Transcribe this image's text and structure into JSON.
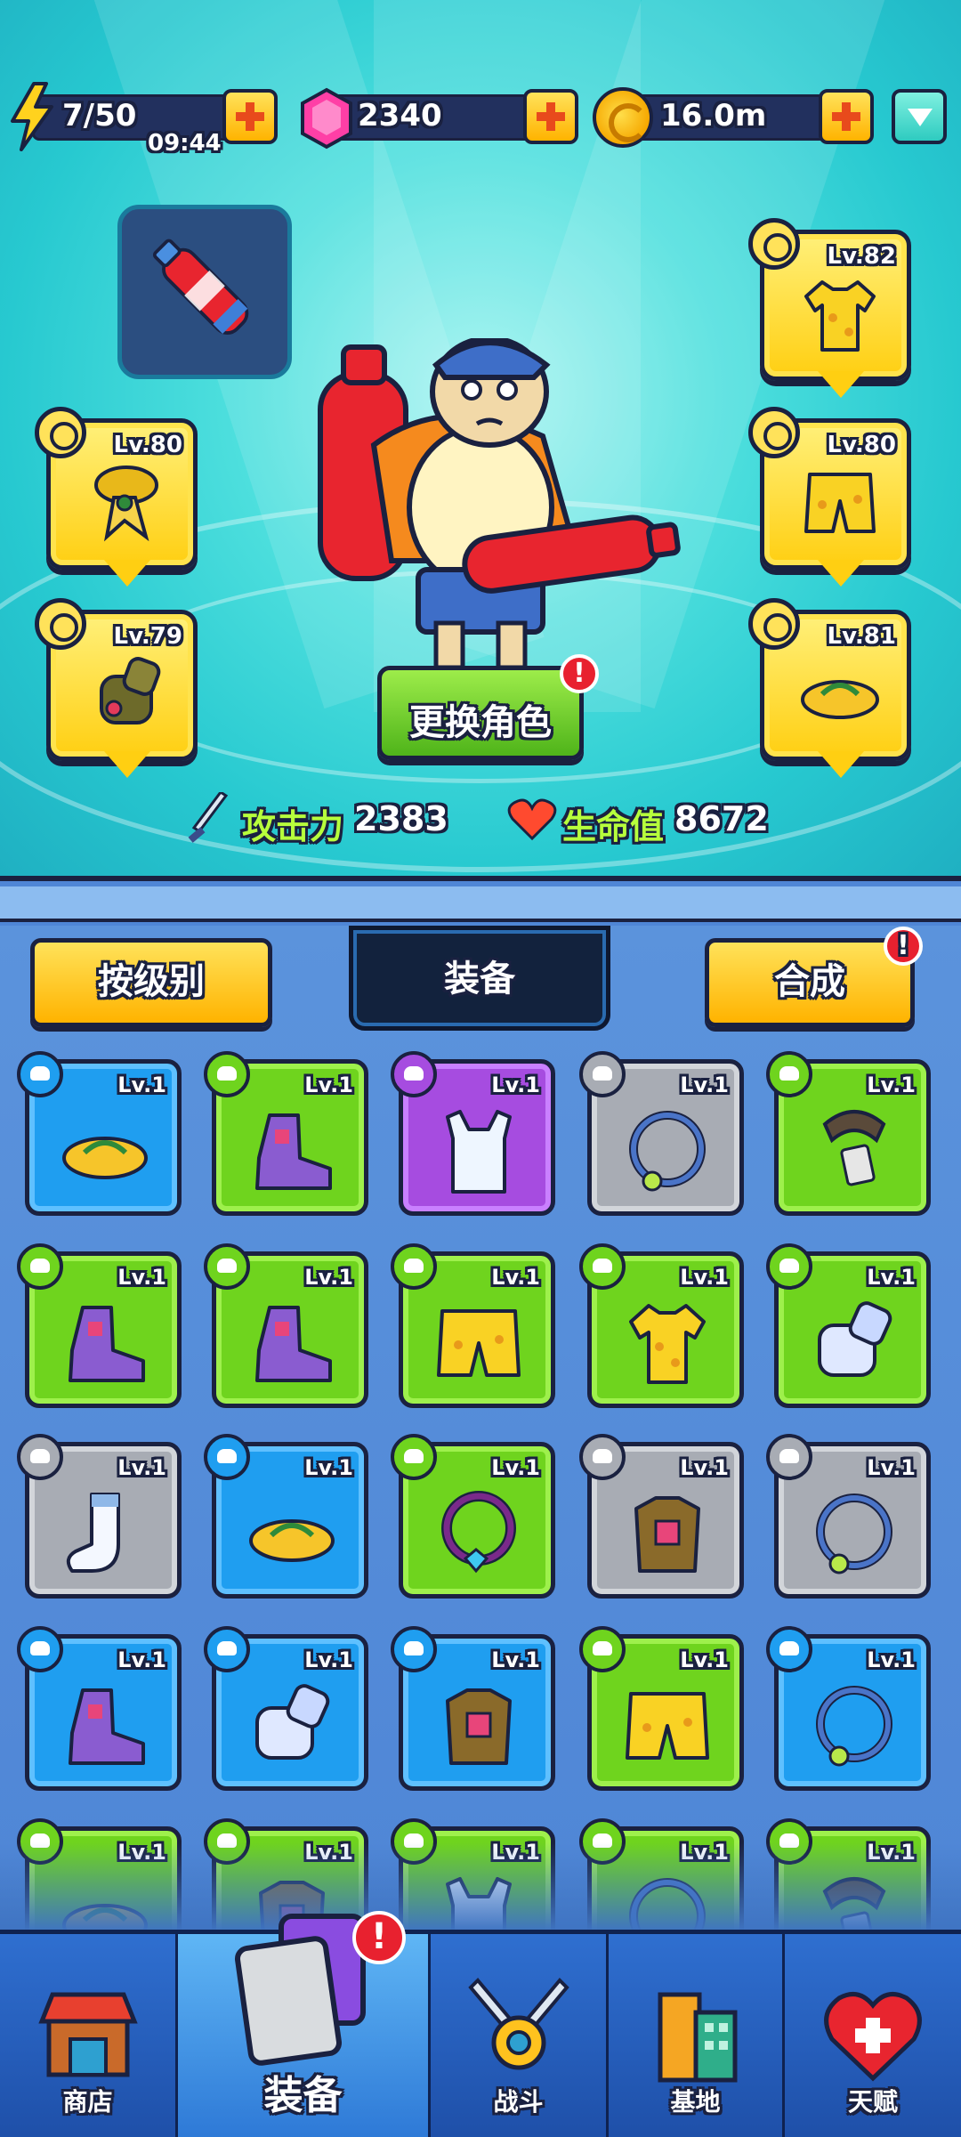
{
  "resources": {
    "energy": "7/50",
    "energy_timer": "09:44",
    "gems": "2340",
    "coins": "16.0m"
  },
  "hero": {
    "swap_button": "更换角色",
    "alert": "!",
    "attack_label": "攻击力",
    "attack_value": "2383",
    "hp_label": "生命值",
    "hp_value": "8672",
    "slots": {
      "left_top": "Lv.80",
      "left_bottom": "Lv.79",
      "right_top": "Lv.82",
      "right_mid": "Lv.80",
      "right_bottom": "Lv.81"
    }
  },
  "inventory": {
    "sort_button": "按级别",
    "title": "装备",
    "merge_button": "合成",
    "merge_alert": "!",
    "level": "Lv.1",
    "items": [
      {
        "rarity": "blue",
        "icon": "sandal-icon"
      },
      {
        "rarity": "green",
        "icon": "boot-icon"
      },
      {
        "rarity": "purple",
        "icon": "tank-top-icon"
      },
      {
        "rarity": "gray",
        "icon": "necklace-icon"
      },
      {
        "rarity": "green",
        "icon": "necklace-tag-icon"
      },
      {
        "rarity": "green",
        "icon": "boot-icon"
      },
      {
        "rarity": "green",
        "icon": "boot-icon"
      },
      {
        "rarity": "green",
        "icon": "shorts-icon"
      },
      {
        "rarity": "green",
        "icon": "shirt-icon"
      },
      {
        "rarity": "green",
        "icon": "glove-icon"
      },
      {
        "rarity": "gray",
        "icon": "sock-icon"
      },
      {
        "rarity": "blue",
        "icon": "sandal-icon"
      },
      {
        "rarity": "green",
        "icon": "gem-necklace-icon"
      },
      {
        "rarity": "gray",
        "icon": "armor-icon"
      },
      {
        "rarity": "gray",
        "icon": "necklace-icon"
      },
      {
        "rarity": "blue",
        "icon": "boot-icon"
      },
      {
        "rarity": "blue",
        "icon": "glove-icon"
      },
      {
        "rarity": "blue",
        "icon": "armor-icon"
      },
      {
        "rarity": "green",
        "icon": "shorts-icon"
      },
      {
        "rarity": "blue",
        "icon": "necklace-icon"
      },
      {
        "rarity": "green",
        "icon": "sandal-icon"
      },
      {
        "rarity": "green",
        "icon": "armor-icon"
      },
      {
        "rarity": "green",
        "icon": "tank-top-icon"
      },
      {
        "rarity": "green",
        "icon": "necklace-icon"
      },
      {
        "rarity": "green",
        "icon": "necklace-tag-icon"
      }
    ]
  },
  "nav": {
    "shop": "商店",
    "equipment": "装备",
    "battle": "战斗",
    "base": "基地",
    "talent": "天赋",
    "equipment_alert": "!"
  }
}
